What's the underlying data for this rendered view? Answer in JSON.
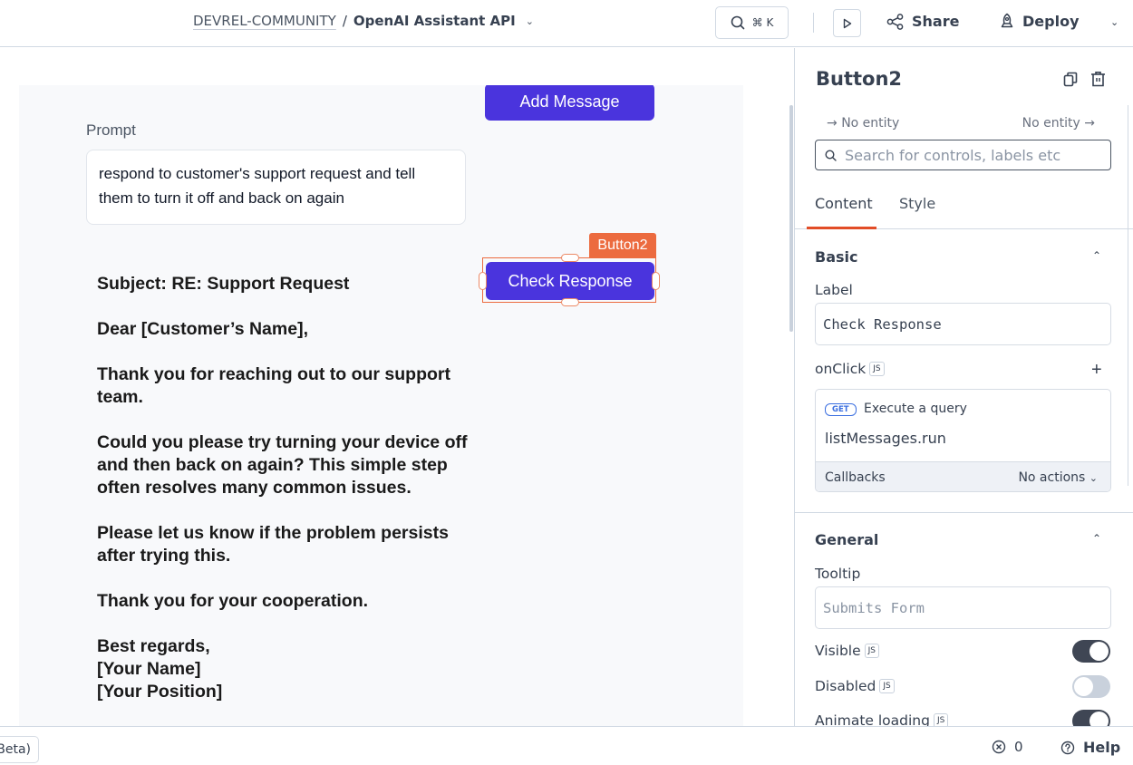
{
  "header": {
    "workspace": "DEVREL-COMMUNITY",
    "separator": "/",
    "app_name": "OpenAI Assistant API",
    "search_shortcut": "⌘ K",
    "share_label": "Share",
    "deploy_label": "Deploy"
  },
  "canvas": {
    "add_message_label": "Add Message",
    "prompt_label": "Prompt",
    "prompt_value": "respond to customer's support request and tell them to turn it off and back on again",
    "selected_widget_tag": "Button2",
    "check_response_label": "Check Response",
    "response_paragraphs": [
      "Subject: RE: Support Request",
      "Dear [Customer’s Name],",
      "Thank you for reaching out to our support team.",
      "Could you please try turning your device off and then back on again? This simple step often resolves many common issues.",
      "Please let us know if the problem persists after trying this.",
      "Thank you for your cooperation.",
      "Best regards,\n[Your Name]\n[Your Position]"
    ]
  },
  "panel": {
    "widget_name": "Button2",
    "entity_in": "No entity",
    "entity_out": "No entity",
    "search_placeholder": "Search for controls, labels etc",
    "tabs": [
      {
        "label": "Content",
        "active": true
      },
      {
        "label": "Style",
        "active": false
      }
    ],
    "basic": {
      "title": "Basic",
      "label_field": "Label",
      "label_value": "Check Response",
      "onclick_label": "onClick",
      "js_badge": "JS",
      "action": {
        "method": "GET",
        "description": "Execute a query",
        "query": "listMessages.run",
        "callbacks_label": "Callbacks",
        "callbacks_value": "No actions"
      }
    },
    "general": {
      "title": "General",
      "tooltip_label": "Tooltip",
      "tooltip_placeholder": "Submits Form",
      "toggles": [
        {
          "label": "Visible",
          "on": true
        },
        {
          "label": "Disabled",
          "on": false
        },
        {
          "label": "Animate loading",
          "on": true
        }
      ]
    }
  },
  "footer": {
    "beta_label": "Beta)",
    "error_count": "0",
    "help_label": "Help"
  },
  "colors": {
    "primary_button": "#4a34dd",
    "selection": "#ec6b3f",
    "tab_underline": "#e24d27"
  }
}
